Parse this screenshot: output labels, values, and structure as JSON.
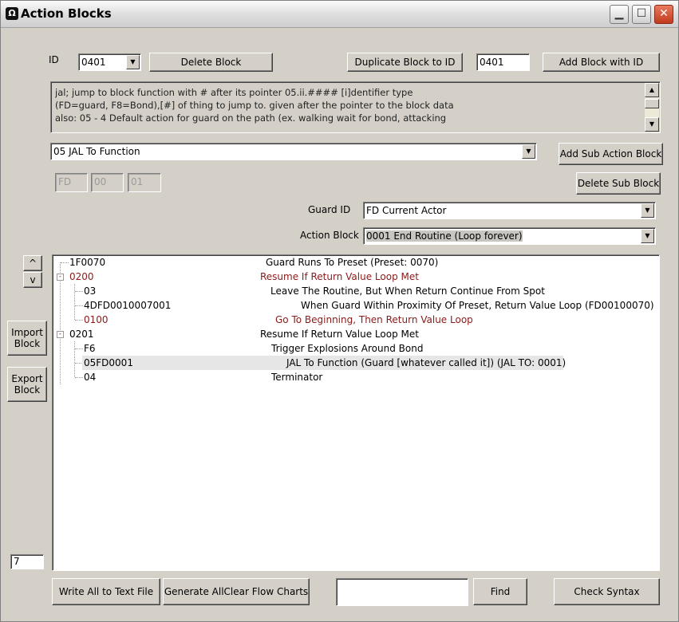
{
  "window": {
    "title": "Action Blocks",
    "minimize": "▁",
    "maximize": "☐",
    "close": "✕",
    "app_icon": "Ω"
  },
  "id_label": "ID",
  "id_select": {
    "value": "0401"
  },
  "buttons": {
    "delete_block": "Delete Block",
    "duplicate_block": "Duplicate Block to ID",
    "add_block": "Add Block with ID",
    "add_sub_action": "Add Sub Action Block",
    "delete_sub": "Delete Sub Block",
    "import_block": "Import\nBlock",
    "export_block": "Export\nBlock",
    "move_up": "^",
    "move_down": "v",
    "write_all": "Write All to Text File",
    "generate_charts": "Generate AllClear Flow Charts",
    "find": "Find",
    "check_syntax": "Check Syntax"
  },
  "target_id_input": {
    "value": "0401"
  },
  "description_lines": [
    "jal; jump to block function with # after its pointer 05.ii.#### [i]dentifier type",
    "(FD=guard, F8=Bond),[#] of thing to jump to.  given after the pointer to the block data",
    "also: 05 - 4 Default action for guard on the path (ex. walking wait for bond, attacking"
  ],
  "action_select": {
    "value": "05 JAL To Function"
  },
  "param_fields": [
    "FD",
    "00",
    "01"
  ],
  "guard_id": {
    "label": "Guard ID",
    "value": "FD Current Actor"
  },
  "action_block": {
    "label": "Action Block",
    "value": "0001 End Routine (Loop forever)"
  },
  "tree_rows": [
    {
      "code": "1F0070",
      "desc": "Guard Runs  To Preset (Preset: 0070)",
      "red": false,
      "toggle": "",
      "selected": false
    },
    {
      "code": "0200",
      "desc": "Resume If Return Value Loop Met",
      "red": true,
      "toggle": "-",
      "selected": false
    },
    {
      "code": "03",
      "desc": "Leave The Routine, But When Return Continue From Spot",
      "red": false,
      "toggle": "",
      "selected": false
    },
    {
      "code": "4DFD0010007001",
      "desc": "When Guard Within Proximity Of Preset, Return Value Loop (FD00100070)",
      "red": false,
      "toggle": "",
      "selected": false
    },
    {
      "code": "0100",
      "desc": "Go To Beginning, Then Return Value Loop",
      "red": true,
      "toggle": "",
      "selected": false
    },
    {
      "code": "0201",
      "desc": "Resume If Return Value Loop Met",
      "red": false,
      "toggle": "-",
      "selected": false
    },
    {
      "code": "F6",
      "desc": "Trigger Explosions Around Bond",
      "red": false,
      "toggle": "",
      "selected": false
    },
    {
      "code": "05FD0001",
      "desc": "JAL To Function (Guard [whatever called it]) (JAL TO: 0001)",
      "red": false,
      "toggle": "",
      "selected": true
    },
    {
      "code": "04",
      "desc": "Terminator",
      "red": false,
      "toggle": "",
      "selected": false
    }
  ],
  "count_field": {
    "value": "7"
  },
  "find_input": {
    "value": ""
  },
  "colors": {
    "red_text": "#8b1a1a",
    "face": "#d4d0c8",
    "selected_row": "#e6e6e6"
  }
}
